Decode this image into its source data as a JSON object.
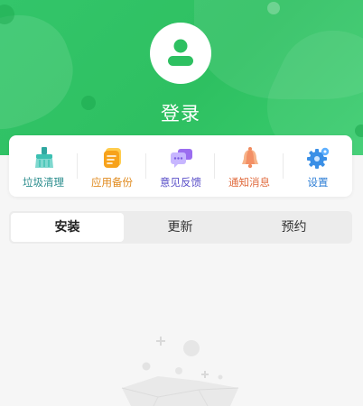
{
  "header": {
    "login_label": "登录",
    "avatar_icon": "user-avatar-icon",
    "bg_color": "#33c56a"
  },
  "quick_actions": [
    {
      "label": "垃圾清理",
      "icon": "broom-icon",
      "color": "#2a8c8c"
    },
    {
      "label": "应用备份",
      "icon": "backup-icon",
      "color": "#e08a1e"
    },
    {
      "label": "意见反馈",
      "icon": "feedback-icon",
      "color": "#5a4fc8"
    },
    {
      "label": "通知消息",
      "icon": "bell-icon",
      "color": "#e06a3c"
    },
    {
      "label": "设置",
      "icon": "gear-icon",
      "color": "#2f7fd6"
    }
  ],
  "tabs": [
    {
      "label": "安装",
      "active": true
    },
    {
      "label": "更新",
      "active": false
    },
    {
      "label": "预约",
      "active": false
    }
  ],
  "empty_state": {
    "icon": "empty-box-icon"
  }
}
